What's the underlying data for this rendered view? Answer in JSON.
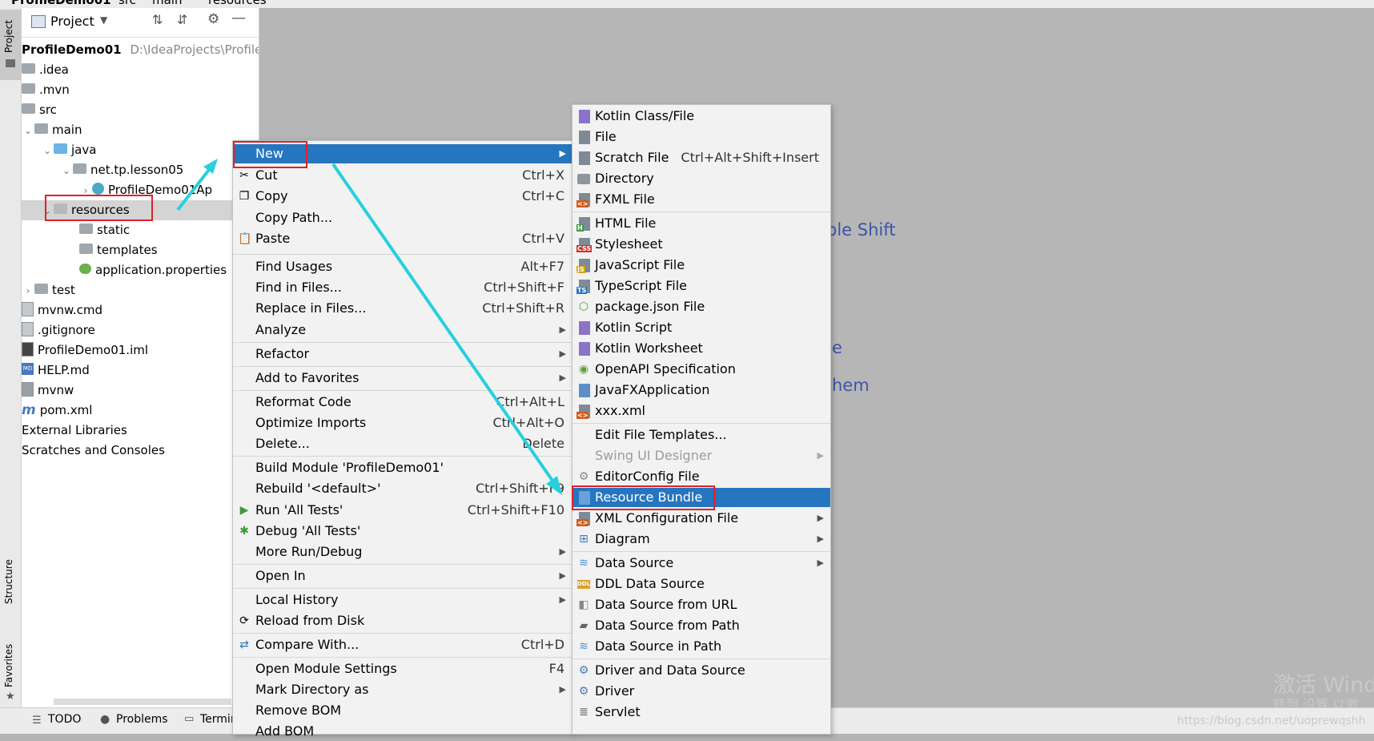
{
  "breadcrumb": [
    "ProfileDemo01",
    "src",
    "main",
    "resources"
  ],
  "tool_stripe": {
    "project_label": "Project",
    "structure_label": "Structure",
    "favorites_label": "Favorites"
  },
  "project_panel": {
    "view_selector": "Project",
    "root_name": "ProfileDemo01",
    "root_path": "D:\\IdeaProjects\\ProfileDe",
    "tree": [
      {
        "label": ".idea"
      },
      {
        "label": ".mvn"
      },
      {
        "label": "src"
      },
      {
        "label": "main"
      },
      {
        "label": "java"
      },
      {
        "label": "net.tp.lesson05"
      },
      {
        "label": "ProfileDemo01Ap"
      },
      {
        "label": "resources"
      },
      {
        "label": "static"
      },
      {
        "label": "templates"
      },
      {
        "label": "application.properties"
      },
      {
        "label": "test"
      },
      {
        "label": "mvnw.cmd"
      },
      {
        "label": ".gitignore"
      },
      {
        "label": "ProfileDemo01.iml"
      },
      {
        "label": "HELP.md"
      },
      {
        "label": "mvnw"
      },
      {
        "label": "pom.xml"
      },
      {
        "label": "External Libraries"
      },
      {
        "label": "Scratches and Consoles"
      }
    ]
  },
  "editor_hints": [
    "ble Shift",
    "e",
    "hem"
  ],
  "bottom_bar": {
    "todo": "TODO",
    "problems": "Problems",
    "terminal": "Termin"
  },
  "context_menu": [
    {
      "label": "New",
      "shortcut": ""
    },
    {
      "label": "Cut",
      "shortcut": "Ctrl+X"
    },
    {
      "label": "Copy",
      "shortcut": "Ctrl+C"
    },
    {
      "label": "Copy Path...",
      "shortcut": ""
    },
    {
      "label": "Paste",
      "shortcut": "Ctrl+V"
    },
    {
      "label": "Find Usages",
      "shortcut": "Alt+F7"
    },
    {
      "label": "Find in Files...",
      "shortcut": "Ctrl+Shift+F"
    },
    {
      "label": "Replace in Files...",
      "shortcut": "Ctrl+Shift+R"
    },
    {
      "label": "Analyze",
      "shortcut": ""
    },
    {
      "label": "Refactor",
      "shortcut": ""
    },
    {
      "label": "Add to Favorites",
      "shortcut": ""
    },
    {
      "label": "Reformat Code",
      "shortcut": "Ctrl+Alt+L"
    },
    {
      "label": "Optimize Imports",
      "shortcut": "Ctrl+Alt+O"
    },
    {
      "label": "Delete...",
      "shortcut": "Delete"
    },
    {
      "label": "Build Module 'ProfileDemo01'",
      "shortcut": ""
    },
    {
      "label": "Rebuild '<default>'",
      "shortcut": "Ctrl+Shift+F9"
    },
    {
      "label": "Run 'All Tests'",
      "shortcut": "Ctrl+Shift+F10"
    },
    {
      "label": "Debug 'All Tests'",
      "shortcut": ""
    },
    {
      "label": "More Run/Debug",
      "shortcut": ""
    },
    {
      "label": "Open In",
      "shortcut": ""
    },
    {
      "label": "Local History",
      "shortcut": ""
    },
    {
      "label": "Reload from Disk",
      "shortcut": ""
    },
    {
      "label": "Compare With...",
      "shortcut": "Ctrl+D"
    },
    {
      "label": "Open Module Settings",
      "shortcut": "F4"
    },
    {
      "label": "Mark Directory as",
      "shortcut": ""
    },
    {
      "label": "Remove BOM",
      "shortcut": ""
    },
    {
      "label": "Add BOM",
      "shortcut": ""
    }
  ],
  "new_submenu": [
    {
      "label": "Kotlin Class/File",
      "shortcut": ""
    },
    {
      "label": "File",
      "shortcut": ""
    },
    {
      "label": "Scratch File",
      "shortcut": "Ctrl+Alt+Shift+Insert"
    },
    {
      "label": "Directory",
      "shortcut": ""
    },
    {
      "label": "FXML File",
      "shortcut": ""
    },
    {
      "label": "HTML File",
      "shortcut": ""
    },
    {
      "label": "Stylesheet",
      "shortcut": ""
    },
    {
      "label": "JavaScript File",
      "shortcut": ""
    },
    {
      "label": "TypeScript File",
      "shortcut": ""
    },
    {
      "label": "package.json File",
      "shortcut": ""
    },
    {
      "label": "Kotlin Script",
      "shortcut": ""
    },
    {
      "label": "Kotlin Worksheet",
      "shortcut": ""
    },
    {
      "label": "OpenAPI Specification",
      "shortcut": ""
    },
    {
      "label": "JavaFXApplication",
      "shortcut": ""
    },
    {
      "label": "xxx.xml",
      "shortcut": ""
    },
    {
      "label": "Edit File Templates...",
      "shortcut": ""
    },
    {
      "label": "Swing UI Designer",
      "shortcut": ""
    },
    {
      "label": "EditorConfig File",
      "shortcut": ""
    },
    {
      "label": "Resource Bundle",
      "shortcut": ""
    },
    {
      "label": "XML Configuration File",
      "shortcut": ""
    },
    {
      "label": "Diagram",
      "shortcut": ""
    },
    {
      "label": "Data Source",
      "shortcut": ""
    },
    {
      "label": "DDL Data Source",
      "shortcut": ""
    },
    {
      "label": "Data Source from URL",
      "shortcut": ""
    },
    {
      "label": "Data Source from Path",
      "shortcut": ""
    },
    {
      "label": "Data Source in Path",
      "shortcut": ""
    },
    {
      "label": "Driver and Data Source",
      "shortcut": ""
    },
    {
      "label": "Driver",
      "shortcut": ""
    },
    {
      "label": "Servlet",
      "shortcut": ""
    }
  ],
  "badges": {
    "fxml": "<>",
    "html": "H",
    "css": "CSS",
    "js": "JS",
    "ts": "TS",
    "ddl": "DDL",
    "xml": "<>",
    "md": "MD"
  },
  "watermark": {
    "line1": "激活 Wind",
    "line2": "转到 设置 以激",
    "url": "https://blog.csdn.net/uoprewqshh"
  },
  "colors": {
    "selection": "#2675bf",
    "highlight_box": "#e0202a",
    "annotation_arrow": "#27d0dc",
    "editor_bg": "#b6b6b6"
  }
}
